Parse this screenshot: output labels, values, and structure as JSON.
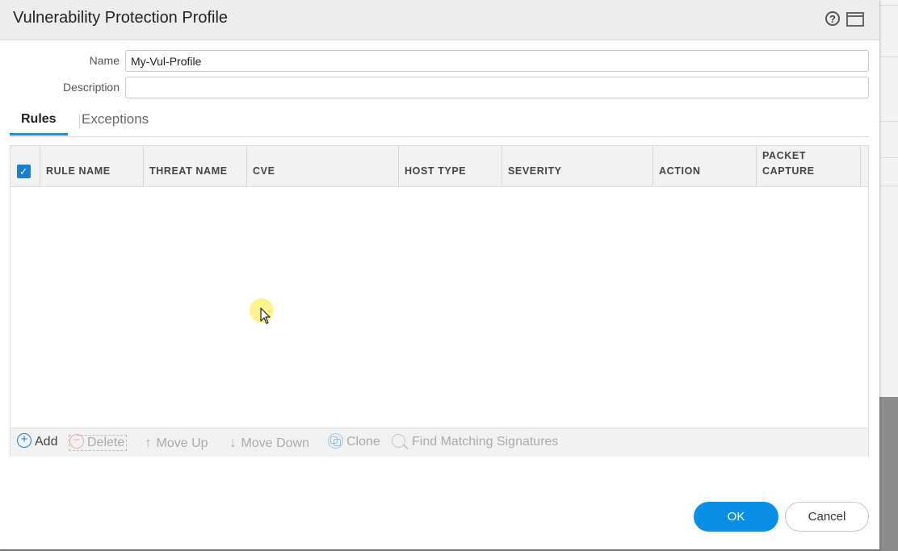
{
  "dialog": {
    "title": "Vulnerability Protection Profile",
    "help_glyph": "?"
  },
  "form": {
    "name_label": "Name",
    "name_value": "My-Vul-Profile",
    "description_label": "Description",
    "description_value": ""
  },
  "tabs": [
    {
      "label": "Rules",
      "active": true
    },
    {
      "label": "Exceptions",
      "active": false
    }
  ],
  "table": {
    "select_all_checked": true,
    "columns": [
      "RULE NAME",
      "THREAT NAME",
      "CVE",
      "HOST TYPE",
      "SEVERITY",
      "ACTION",
      "PACKET CAPTURE"
    ],
    "rows": []
  },
  "toolbar": {
    "add": "Add",
    "delete": "Delete",
    "move_up": "Move Up",
    "move_down": "Move Down",
    "clone": "Clone",
    "find_matching": "Find Matching Signatures"
  },
  "footer": {
    "ok": "OK",
    "cancel": "Cancel"
  },
  "colors": {
    "accent": "#0a8fe6",
    "tab_underline": "#1a8fd8"
  }
}
